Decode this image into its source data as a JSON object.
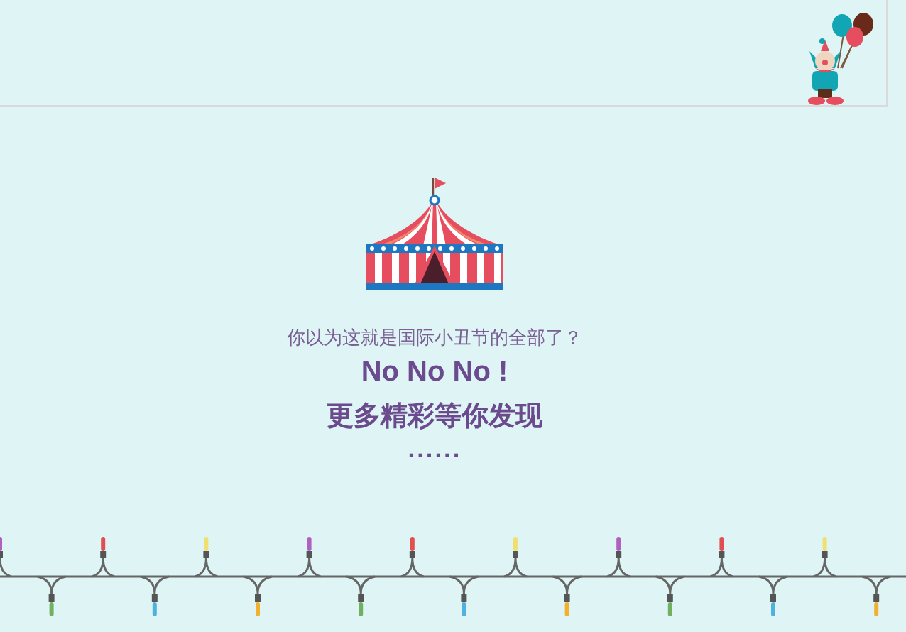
{
  "question": "你以为这就是国际小丑节的全部了？",
  "answer": "No No No !",
  "teaser": "更多精彩等你发现",
  "ellipsis": "......"
}
